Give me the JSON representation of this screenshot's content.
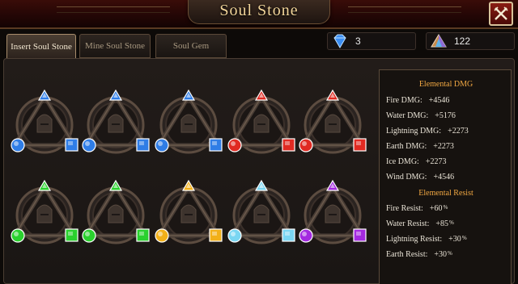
{
  "window": {
    "title": "Soul Stone",
    "close_icon": "crossed-swords-icon"
  },
  "tabs": [
    {
      "label": "Insert Soul Stone",
      "active": true
    },
    {
      "label": "Mine Soul Stone",
      "active": false
    },
    {
      "label": "Soul Gem",
      "active": false
    }
  ],
  "currency": {
    "diamond": {
      "icon": "blue-diamond-icon",
      "value": "3"
    },
    "crystal": {
      "icon": "prism-crystal-icon",
      "value": "122"
    }
  },
  "slots": [
    {
      "rune": "helmet",
      "element": "water",
      "color": "#2f7de6"
    },
    {
      "rune": "sword",
      "element": "water",
      "color": "#2f7de6"
    },
    {
      "rune": "hood",
      "element": "water",
      "color": "#2f7de6"
    },
    {
      "rune": "sword",
      "element": "fire",
      "color": "#e02a22"
    },
    {
      "rune": "hood",
      "element": "fire",
      "color": "#e02a22"
    },
    {
      "rune": "helmet",
      "element": "wind",
      "color": "#2ad12e"
    },
    {
      "rune": "helmet",
      "element": "wind",
      "color": "#2ad12e"
    },
    {
      "rune": "chest",
      "element": "lightning",
      "color": "#f2b019"
    },
    {
      "rune": "armor",
      "element": "ice",
      "color": "#7ad6f2"
    },
    {
      "rune": "hood",
      "element": "dark",
      "color": "#a329e0"
    }
  ],
  "stats": {
    "elemental_dmg_header": "Elemental DMG",
    "elemental_dmg": [
      {
        "label": "Fire DMG:",
        "value": "+4546"
      },
      {
        "label": "Water DMG:",
        "value": "+5176"
      },
      {
        "label": "Lightning DMG:",
        "value": "+2273"
      },
      {
        "label": "Earth DMG:",
        "value": "+2273"
      },
      {
        "label": "Ice DMG:",
        "value": "+2273"
      },
      {
        "label": "Wind DMG:",
        "value": "+4546"
      }
    ],
    "elemental_resist_header": "Elemental Resist",
    "elemental_resist": [
      {
        "label": "Fire Resist:",
        "value": "+60",
        "unit": "%"
      },
      {
        "label": "Water Resist:",
        "value": "+85",
        "unit": "%"
      },
      {
        "label": "Lightning Resist:",
        "value": "+30",
        "unit": "%"
      },
      {
        "label": "Earth Resist:",
        "value": "+30",
        "unit": "%"
      }
    ]
  }
}
